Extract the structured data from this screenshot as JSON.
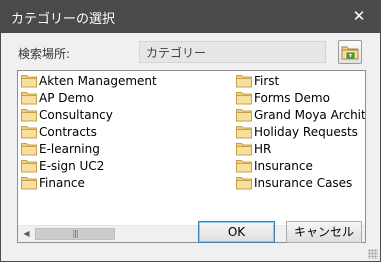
{
  "window": {
    "title": "カテゴリーの選択",
    "close_glyph": "✕"
  },
  "location": {
    "label": "検索場所:",
    "value": "カテゴリー"
  },
  "list": {
    "left_column": [
      "Akten Management",
      "AP Demo",
      "Consultancy",
      "Contracts",
      "E-learning",
      "E-sign UC2",
      "Finance"
    ],
    "right_column": [
      "First",
      "Forms Demo",
      "Grand Moya Architects",
      "Holiday Requests",
      "HR",
      "Insurance",
      "Insurance Cases"
    ]
  },
  "scrollbar": {
    "left_arrow": "◀",
    "right_arrow": "▶",
    "thumb_grip": "|||"
  },
  "buttons": {
    "ok": "OK",
    "cancel": "キャンセル"
  },
  "colors": {
    "titlebar": "#4a4a4a",
    "folder_fill": "#f1d081",
    "folder_stroke": "#c9a04a"
  },
  "icons": {
    "folder": "folder-icon",
    "browse": "new-folder-icon",
    "close": "close-icon"
  }
}
